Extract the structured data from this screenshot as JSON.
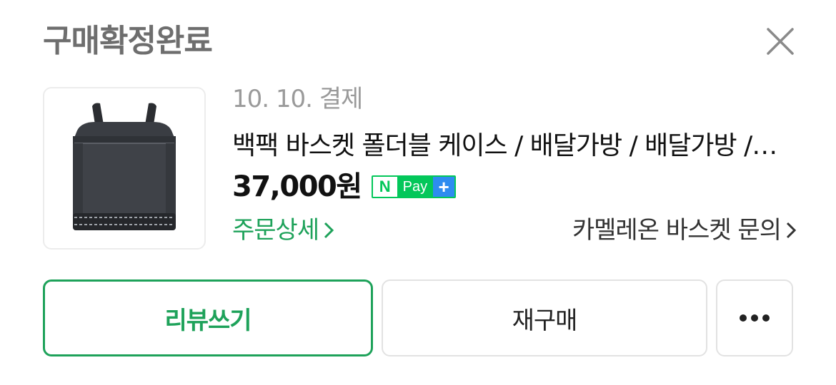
{
  "header": {
    "status_title": "구매확정완료"
  },
  "order": {
    "date": "10. 10. 결제",
    "product_name": "백팩 바스켓 폴더블 케이스 / 배달가방 / 배달가방 / 배달",
    "price": "37,000원",
    "payment_badge": {
      "n": "N",
      "pay": "Pay",
      "plus": "+"
    },
    "detail_link": "주문상세",
    "seller_inquiry_link": "카멜레온 바스켓 문의"
  },
  "actions": {
    "review_label": "리뷰쓰기",
    "rebuy_label": "재구매",
    "more_icon": "more-dots-icon"
  },
  "colors": {
    "accent_green": "#1ea25a",
    "npay_green": "#03c75a",
    "npay_blue": "#2d8cf0",
    "title_gray": "#6e6e6e",
    "date_gray": "#9a9a9a"
  }
}
